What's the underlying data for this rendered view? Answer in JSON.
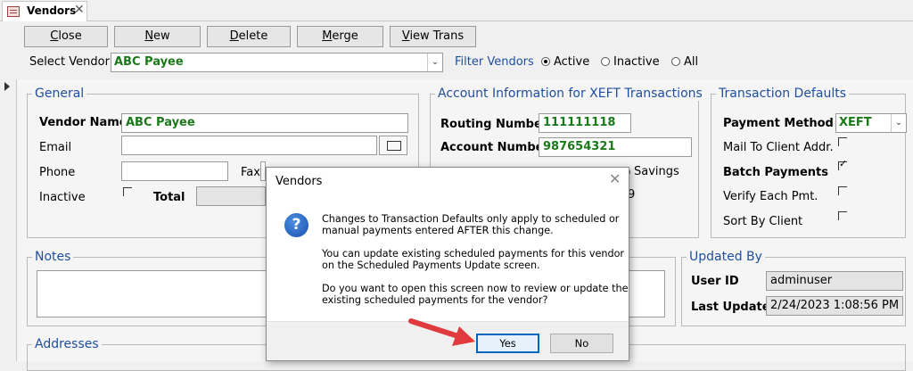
{
  "tab": {
    "label": "Vendors",
    "close_glyph": "✕",
    "icon": "form-icon"
  },
  "toolbar": {
    "close_label": "Close",
    "new_label": "New",
    "delete_label": "Delete",
    "merge_label": "Merge",
    "view_trans_label": "View Trans"
  },
  "select_vendor": {
    "label": "Select Vendor",
    "value": "ABC Payee"
  },
  "filter": {
    "label": "Filter Vendors",
    "options": [
      {
        "label": "Active",
        "selected": true
      },
      {
        "label": "Inactive",
        "selected": false
      },
      {
        "label": "All",
        "selected": false
      }
    ]
  },
  "general": {
    "title": "General",
    "vendor_name_label": "Vendor Name",
    "vendor_name_value": "ABC Payee",
    "email_label": "Email",
    "email_value": "",
    "phone_label": "Phone",
    "phone_value": "",
    "fax_label": "Fax",
    "inactive_label": "Inactive",
    "inactive_checked": false,
    "total_label": "Total"
  },
  "account": {
    "title": "Account Information for XEFT Transactions",
    "routing_label": "Routing Number",
    "routing_value": "111111118",
    "account_label": "Account Number",
    "account_value": "987654321",
    "savings_label": "Savings",
    "partial_value": "9"
  },
  "transaction_defaults": {
    "title": "Transaction Defaults",
    "payment_method_label": "Payment Method",
    "payment_method_value": "XEFT",
    "mail_to_client_label": "Mail To Client Addr.",
    "mail_to_client_checked": false,
    "batch_payments_label": "Batch Payments",
    "batch_payments_checked": true,
    "verify_each_label": "Verify Each Pmt.",
    "verify_each_checked": false,
    "sort_by_client_label": "Sort By Client",
    "sort_by_client_checked": false
  },
  "notes": {
    "title": "Notes"
  },
  "updated_by": {
    "title": "Updated By",
    "user_id_label": "User ID",
    "user_id_value": "adminuser",
    "last_updated_label": "Last Updated",
    "last_updated_value": "2/24/2023 1:08:56 PM"
  },
  "addresses": {
    "title": "Addresses"
  },
  "dialog": {
    "title": "Vendors",
    "close_glyph": "✕",
    "icon_glyph": "?",
    "message_lines_1": [
      "Changes to Transaction Defaults only apply to scheduled or",
      "manual payments entered AFTER this change."
    ],
    "message_lines_2": [
      "You can update existing scheduled payments for this vendor",
      "on the Scheduled Payments Update screen."
    ],
    "message_lines_3": [
      "Do you want to open this screen now to review or update the",
      "existing scheduled payments for the vendor?"
    ],
    "yes_label": "Yes",
    "no_label": "No"
  },
  "colors": {
    "accent_blue": "#1f4e9b",
    "value_green": "#1a7a1a",
    "annotation_red": "#e0393e",
    "default_button_border": "#0067c0"
  }
}
